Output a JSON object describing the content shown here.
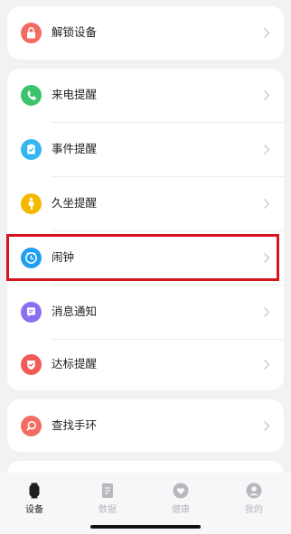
{
  "menu": {
    "unlock": {
      "label": "解锁设备",
      "icon": "lock-icon",
      "color": "#f26c63"
    },
    "call": {
      "label": "来电提醒",
      "icon": "phone-icon",
      "color": "#3cc46a"
    },
    "event": {
      "label": "事件提醒",
      "icon": "calendar-check-icon",
      "color": "#34b7f1"
    },
    "sedentary": {
      "label": "久坐提醒",
      "icon": "person-icon",
      "color": "#f5b800"
    },
    "alarm": {
      "label": "闹钟",
      "icon": "clock-icon",
      "color": "#1e9ff2"
    },
    "notify": {
      "label": "消息通知",
      "icon": "message-icon",
      "color": "#8a6ff2"
    },
    "goal": {
      "label": "达标提醒",
      "icon": "shield-check-icon",
      "color": "#f25a58"
    },
    "find": {
      "label": "查找手环",
      "icon": "search-icon",
      "color": "#f26c63"
    }
  },
  "tabs": [
    {
      "label": "设备",
      "icon": "watch-icon",
      "active": true
    },
    {
      "label": "数据",
      "icon": "document-icon",
      "active": false
    },
    {
      "label": "健康",
      "icon": "heart-icon",
      "active": false
    },
    {
      "label": "我的",
      "icon": "profile-icon",
      "active": false
    }
  ],
  "colors": {
    "background": "#f2f2f4",
    "card": "#ffffff",
    "highlight": "#d7141c",
    "tab_active": "#1f1f1f",
    "tab_inactive": "#b8b8bc"
  }
}
